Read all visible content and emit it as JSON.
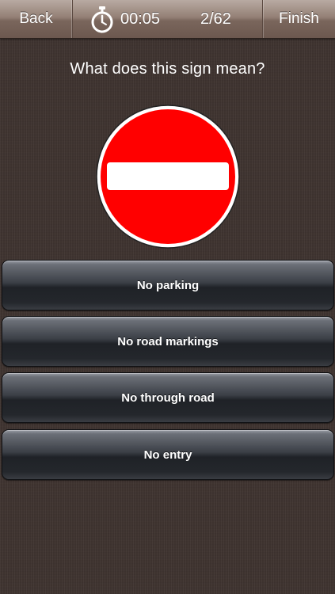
{
  "topbar": {
    "back_label": "Back",
    "timer": "00:05",
    "progress": "2/62",
    "finish_label": "Finish",
    "timer_icon": "stopwatch-icon"
  },
  "question": {
    "text": "What does this sign mean?",
    "sign_icon": "no-entry-sign",
    "sign_color": "#ff0000",
    "bar_color": "#ffffff"
  },
  "answers": [
    {
      "label": "No parking"
    },
    {
      "label": "No road markings"
    },
    {
      "label": "No through road"
    },
    {
      "label": "No entry"
    }
  ],
  "colors": {
    "background": "#3f3430",
    "topbar": "#7a665c",
    "button_dark": "#1f2227"
  }
}
